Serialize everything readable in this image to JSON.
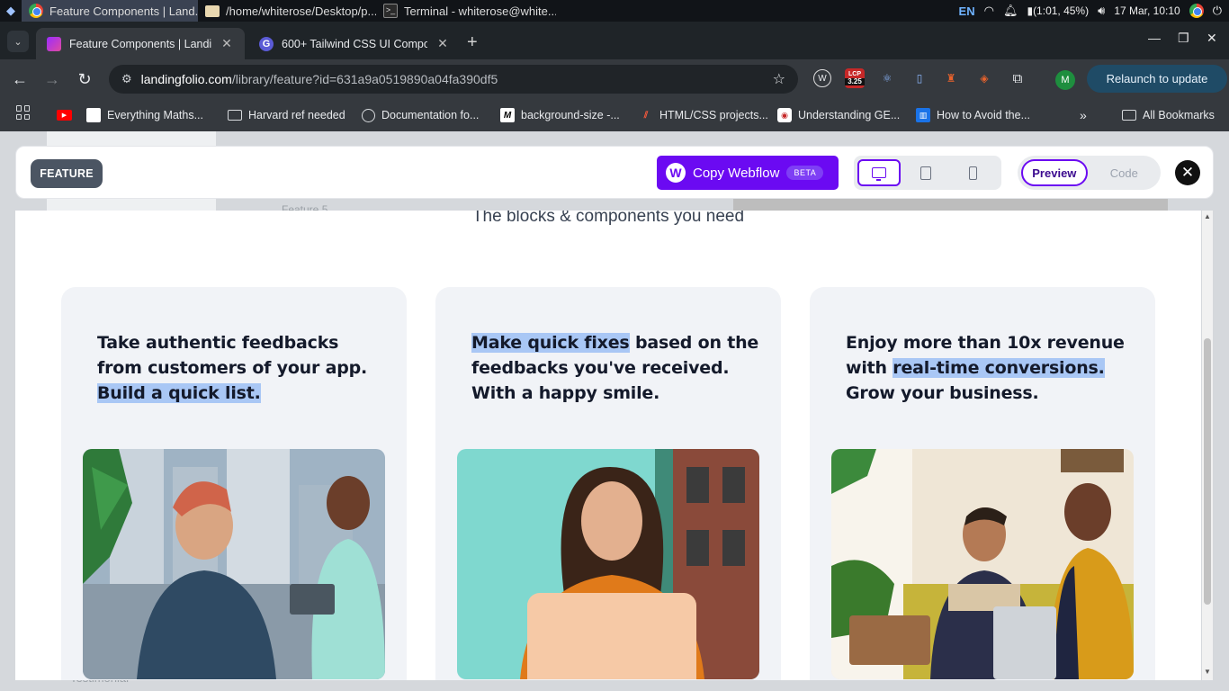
{
  "os_bar": {
    "tasks": [
      {
        "title": "Feature Components | Land..."
      },
      {
        "title": "/home/whiterose/Desktop/p..."
      },
      {
        "title": "Terminal - whiterose@white..."
      }
    ],
    "lang": "EN",
    "battery": "(1:01, 45%)",
    "datetime": "17 Mar, 10:10"
  },
  "tabs": [
    {
      "title": "Feature Components | Landi",
      "active": true
    },
    {
      "title": "600+ Tailwind CSS UI Compon",
      "active": false
    }
  ],
  "toolbar": {
    "url_domain": "landingfolio.com",
    "url_path": "/library/feature?id=631a9a0519890a04fa390df5",
    "lcp_label": "LCP",
    "lcp_value": "3.25",
    "profile_initial": "M",
    "relaunch_label": "Relaunch to update"
  },
  "bookmarks": [
    {
      "label": "Everything Maths..."
    },
    {
      "label": "Harvard ref needed"
    },
    {
      "label": "Documentation fo..."
    },
    {
      "label": "background-size -..."
    },
    {
      "label": "HTML/CSS projects..."
    },
    {
      "label": "Understanding GE..."
    },
    {
      "label": "How to Avoid the..."
    }
  ],
  "all_bookmarks_label": "All Bookmarks",
  "panel": {
    "category": "FEATURE",
    "copy_webflow": "Copy Webflow",
    "beta": "BETA",
    "preview": "Preview",
    "code": "Code"
  },
  "background": {
    "ghost_item": "Feature 5",
    "ghost_bottom": "Testimonial"
  },
  "preview": {
    "subtitle": "The blocks & components you need",
    "cards": [
      {
        "pre": "Take authentic feedbacks from customers of your app. ",
        "highlight": "Build a quick list.",
        "post": ""
      },
      {
        "pre": "",
        "highlight": "Make quick fixes",
        "post": " based on the feedbacks you've received. With a happy smile."
      },
      {
        "pre": "Enjoy more than 10x revenue with ",
        "highlight": "real-time conversions.",
        "post": " Grow your business."
      }
    ]
  }
}
